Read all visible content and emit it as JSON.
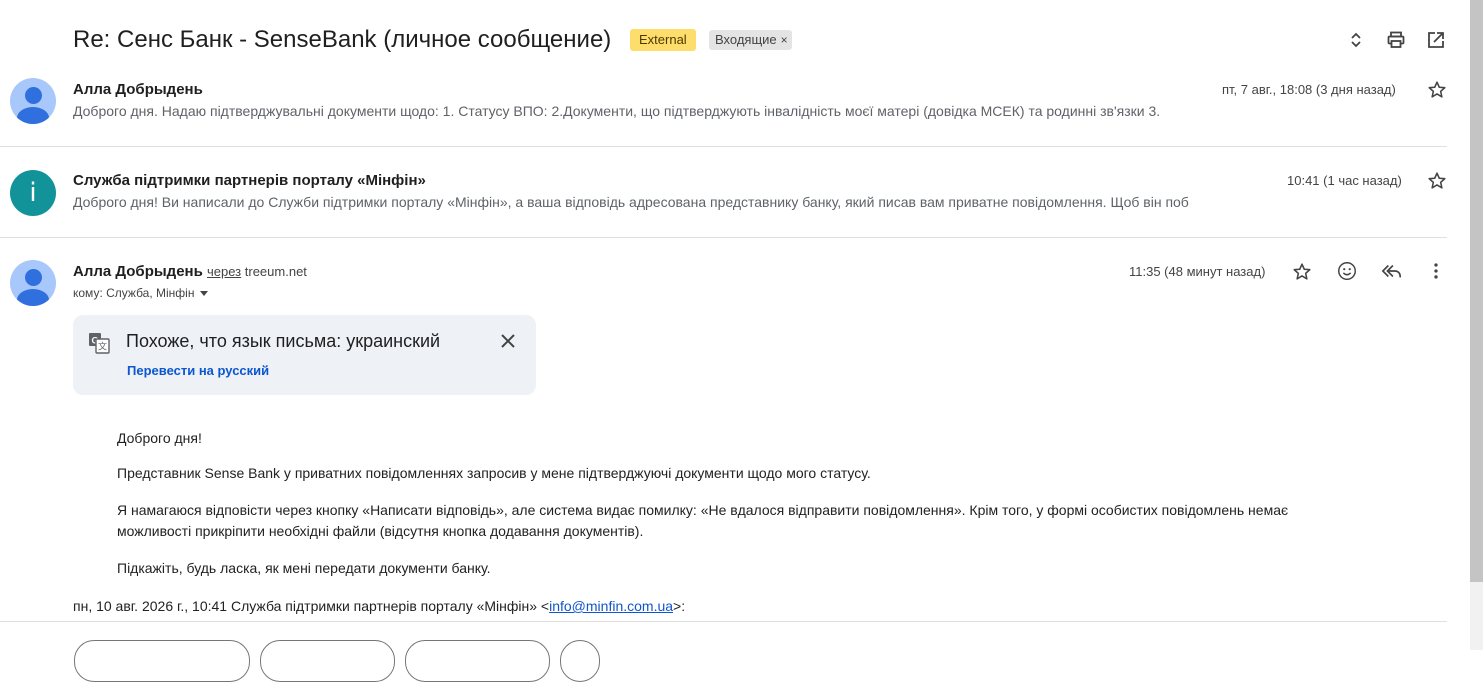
{
  "thread": {
    "subject": "Re: Сенс Банк - SenseBank (личное сообщение)",
    "labels": {
      "external": "External",
      "inbox": "Входящие",
      "remove": "×"
    }
  },
  "messages": [
    {
      "sender": "Алла Добрыдень",
      "time": "пт, 7 авг., 18:08 (3 дня назад)",
      "snippet": "Доброго дня. Надаю підтверджувальні документи щодо: 1. Статусу ВПО: 2.Документи, що підтверджують інвалідність моєї матері (довідка МСЕК) та родинні зв'язки 3.",
      "avatar": "person-avatar-icon"
    },
    {
      "sender": "Служба підтримки партнерів порталу «Мінфін»",
      "time": "10:41 (1 час назад)",
      "snippet": "Доброго дня! Ви написали до Служби підтримки порталу «Мінфін», а ваша відповідь адресована представнику банку, який писав вам приватне повідомлення. Щоб він поб",
      "avatar_letter": "i"
    }
  ],
  "open_message": {
    "sender": "Алла Добрыдень",
    "via": "через",
    "domain": "treeum.net",
    "time": "11:35 (48 минут назад)",
    "recipients": "кому: Служба, Мінфін",
    "translate_banner": {
      "title": "Похоже, что язык письма: украинский",
      "link": "Перевести на русский"
    },
    "body": [
      "Доброго дня!",
      "Представник Sense Bank у приватних повідомленнях запросив у мене підтверджуючі документи щодо мого статусу.",
      "Я намагаюся відповісти через кнопку «Написати відповідь», але система видає помилку: «Не вдалося відправити повідомлення». Крім того, у формі особистих повідомлень немає можливості прикріпити необхідні файли (відсутня кнопка додавання документів).",
      "Підкажіть, будь ласка, як мені передати документи банку."
    ],
    "quote": {
      "prefix": "пн, 10 авг. 2026 г., 10:41 Служба підтримки партнерів порталу «Мінфін» <",
      "email": "info@minfin.com.ua",
      "suffix": ">:"
    }
  },
  "colors": {
    "external_label": "#fddd6b",
    "avatar_person_bg": "#a8c7fa",
    "avatar_person_fg": "#2f6fde",
    "avatar_info_bg": "#12939a",
    "link": "#0b57d0"
  },
  "icons": [
    "expand-collapse-icon",
    "print-icon",
    "open-in-new-window-icon",
    "star-icon",
    "emoji-reaction-icon",
    "reply-all-icon",
    "more-vert-icon",
    "translate-icon",
    "close-icon"
  ]
}
